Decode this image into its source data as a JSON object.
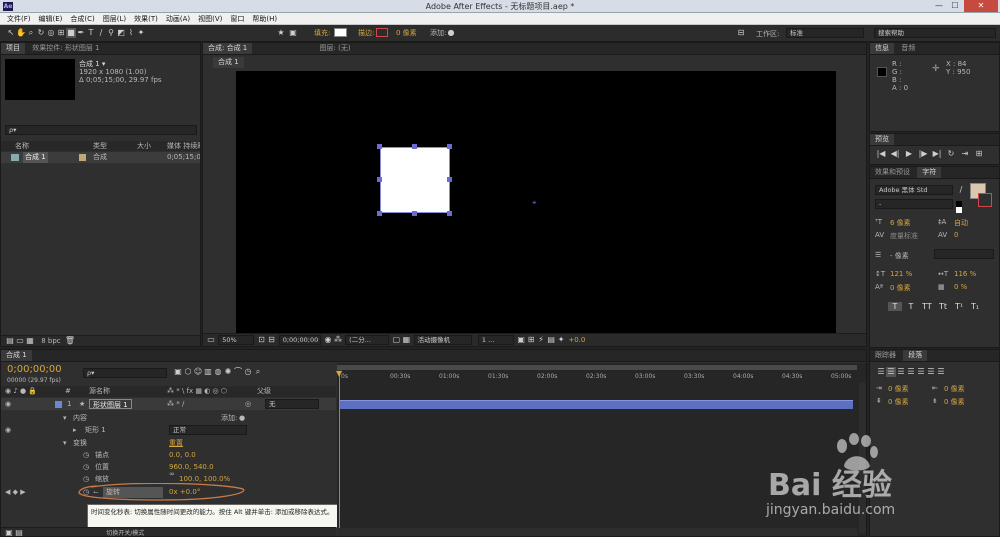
{
  "window": {
    "title": "Adobe After Effects - 无标题项目.aep *",
    "logo": "Ae"
  },
  "menubar": {
    "items": [
      "文件(F)",
      "编辑(E)",
      "合成(C)",
      "图层(L)",
      "效果(T)",
      "动画(A)",
      "视图(V)",
      "窗口",
      "帮助(H)"
    ]
  },
  "toolbar": {
    "fill_label": "填充:",
    "stroke_label": "描边:",
    "stroke_width": "0 像素",
    "add_label": "添加:",
    "workspace_label": "工作区:",
    "workspace_value": "标准",
    "search_placeholder": "搜索帮助"
  },
  "project_panel": {
    "tab_project": "项目",
    "tab_effects": "效果控件: 形状图层 1",
    "comp_name": "合成 1 ▾",
    "comp_size": "1920 x 1080 (1.00)",
    "comp_duration": "Δ 0;05;15;00, 29.97 fps",
    "search_placeholder": "ρ▾",
    "columns": {
      "name": "名称",
      "type": "类型",
      "size": "大小",
      "duration": "媒体 持续时"
    },
    "items": [
      {
        "name": "合成 1",
        "type": "合成",
        "duration": "0;05;15;00"
      }
    ],
    "bpc": "8 bpc"
  },
  "comp_panel": {
    "tab_comp": "合成: 合成 1",
    "tab_layer": "图层: (无)",
    "subtab": "合成 1",
    "zoom": "50%",
    "timecode": "0;00;00;00",
    "resolution": "(二分...",
    "camera": "活动摄像机",
    "views": "1 ...",
    "exposure": "+0.0"
  },
  "info_panel": {
    "tab_info": "信息",
    "tab_audio": "音频",
    "r": "R :",
    "g": "G :",
    "b": "B :",
    "a": "A : 0",
    "x": "X : 84",
    "y": "Y : 950"
  },
  "preview_panel": {
    "tab": "预览",
    "buttons": [
      "|◀",
      "◀|",
      "▶",
      "|▶",
      "▶|",
      "↻",
      "⇥",
      "⊞"
    ]
  },
  "char_panel": {
    "tab_effects": "效果和预设",
    "tab_char": "字符",
    "font": "Adobe 黑体 Std",
    "style": "-",
    "font_size": "6 像素",
    "leading": "自动",
    "kerning": "度量标准",
    "tracking": "0",
    "stroke_width": "- 像素",
    "vscale": "121 %",
    "hscale": "116 %",
    "baseline": "0 像素",
    "tsume": "0 %",
    "styles": [
      "T",
      "T",
      "TT",
      "Tt",
      "T¹",
      "T₁"
    ]
  },
  "para_panel": {
    "tab_tracker": "跟踪器",
    "tab_para": "段落",
    "indent_left": "0 像素",
    "indent_right": "0 像素",
    "space_before": "0 像素",
    "space_after": "0 像素"
  },
  "timeline": {
    "tab": "合成 1",
    "timecode": "0;00;00;00",
    "frame_info": "00000 (29.97 fps)",
    "search_placeholder": "ρ▾",
    "col_num": "#",
    "col_source": "源名称",
    "col_parent": "父级",
    "switches_label": "模式",
    "layer": {
      "num": "1",
      "name": "形状图层 1",
      "parent": "无"
    },
    "content_label": "内容",
    "add_label": "添加:",
    "rect_label": "矩形 1",
    "blend_mode": "正常",
    "transform_label": "变换",
    "reset_label": "重置",
    "props": [
      {
        "name": "锚点",
        "value": "0.0, 0.0"
      },
      {
        "name": "位置",
        "value": "960.0, 540.0"
      },
      {
        "name": "缩放",
        "value": "100.0, 100.0%"
      },
      {
        "name": "旋转",
        "value": "0x +0.0°"
      }
    ],
    "ruler": [
      "0s",
      "00:30s",
      "01:00s",
      "01:30s",
      "02:00s",
      "02:30s",
      "03:00s",
      "03:30s",
      "04:00s",
      "04:30s",
      "05:00s"
    ],
    "tooltip": "时间变化秒表: 切换属性随时间更改的能力。按住 Alt 键并单击: 添加或移除表达式。",
    "footer": "切换开关/模式"
  },
  "watermark": {
    "brand": "Bai 经验",
    "url": "jingyan.baidu.com"
  }
}
